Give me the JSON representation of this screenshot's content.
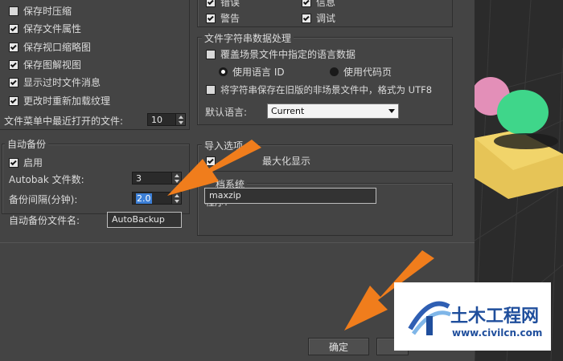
{
  "left_top": {
    "items": [
      {
        "label": "保存时压缩",
        "checked": false
      },
      {
        "label": "保存文件属性",
        "checked": true
      },
      {
        "label": "保存视口缩略图",
        "checked": true
      },
      {
        "label": "保存图解视图",
        "checked": true
      },
      {
        "label": "显示过时文件消息",
        "checked": true
      },
      {
        "label": "更改时重新加载纹理",
        "checked": true
      }
    ],
    "recent_files_label": "文件菜单中最近打开的文件:",
    "recent_files_value": "10"
  },
  "autobackup": {
    "title": "自动备份",
    "enable_label": "启用",
    "enable_checked": true,
    "count_label": "Autobak 文件数:",
    "count_value": "3",
    "interval_label": "备份间隔(分钟):",
    "interval_value": "2.0",
    "filename_label": "自动备份文件名:",
    "filename_value": "AutoBackup"
  },
  "log": {
    "items": [
      {
        "label": "错误",
        "checked": true
      },
      {
        "label": "信息",
        "checked": true
      },
      {
        "label": "警告",
        "checked": true
      },
      {
        "label": "调试",
        "checked": true
      }
    ]
  },
  "strings": {
    "title": "文件字符串数据处理",
    "override_label": "覆盖场景文件中指定的语言数据",
    "override_checked": false,
    "radio_lang_id": "使用语言 ID",
    "radio_codepage": "使用代码页",
    "legacy_label": "将字符串保存在旧版的非场景文件中，格式为 UTF8",
    "legacy_checked": false,
    "default_lang_label": "默认语言:",
    "default_lang_value": "Current"
  },
  "import": {
    "title": "导入选项",
    "zoom_label_visible": "最大化显示",
    "zoom_checked": true
  },
  "archive": {
    "title_visible": "档系统",
    "program_label": "程序:",
    "program_value": "maxzip"
  },
  "footer": {
    "ok_label": "确定"
  },
  "logo": {
    "name": "土木工程网",
    "url": "www.civilcn.com"
  },
  "colors": {
    "panel": "#444444",
    "arrow": "#f07d1c",
    "logo_blue": "#1f4e9c"
  }
}
